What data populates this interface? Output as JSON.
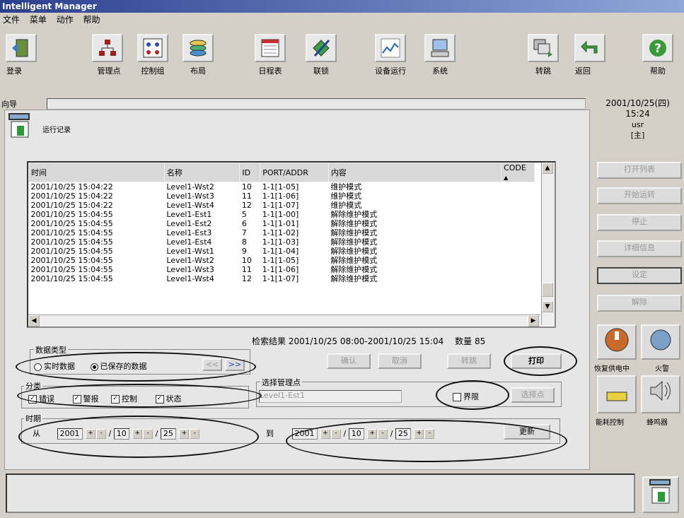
{
  "window": {
    "title": "Intelligent Manager"
  },
  "menu": {
    "file": "文件",
    "menu": "菜单",
    "action": "动作",
    "help": "帮助"
  },
  "toolbar": {
    "login": "登录",
    "mgmt_point": "管理点",
    "control_group": "控制组",
    "layout": "布局",
    "schedule": "日程表",
    "interlock": "联锁",
    "device_run": "设备运行",
    "system": "系统",
    "switch": "转跳",
    "back": "返回",
    "help": "帮助"
  },
  "nav": {
    "label": "向导"
  },
  "page": {
    "title": "运行记录"
  },
  "clock": {
    "date": "2001/10/25(四)",
    "time": "15:24",
    "user": "usr",
    "role": "[主]"
  },
  "side_buttons": {
    "open_list": "打开列表",
    "start_run": "开始运转",
    "stop": "停止",
    "detail": "详细信息",
    "settings": "设定",
    "dismiss": "解除"
  },
  "side_icons": {
    "restore_power": "恢复供电中",
    "fire_alarm": "火警",
    "energy_control": "能耗控制",
    "buzzer": "蜂鸣器"
  },
  "table": {
    "columns": [
      "时间",
      "名称",
      "ID",
      "PORT/ADDR",
      "内容",
      "CODE"
    ],
    "rows": [
      [
        "2001/10/25  15:04:22",
        "Level1-Wst2",
        "10",
        "1-1[1-05]",
        "维护模式",
        ""
      ],
      [
        "2001/10/25  15:04:22",
        "Level1-Wst3",
        "11",
        "1-1[1-06]",
        "维护模式",
        ""
      ],
      [
        "2001/10/25  15:04:22",
        "Level1-Wst4",
        "12",
        "1-1[1-07]",
        "维护模式",
        ""
      ],
      [
        "2001/10/25  15:04:55",
        "Level1-Est1",
        "5",
        "1-1[1-00]",
        "解除维护模式",
        ""
      ],
      [
        "2001/10/25  15:04:55",
        "Level1-Est2",
        "6",
        "1-1[1-01]",
        "解除维护模式",
        ""
      ],
      [
        "2001/10/25  15:04:55",
        "Level1-Est3",
        "7",
        "1-1[1-02]",
        "解除维护模式",
        ""
      ],
      [
        "2001/10/25  15:04:55",
        "Level1-Est4",
        "8",
        "1-1[1-03]",
        "解除维护模式",
        ""
      ],
      [
        "2001/10/25  15:04:55",
        "Level1-Wst1",
        "9",
        "1-1[1-04]",
        "解除维护模式",
        ""
      ],
      [
        "2001/10/25  15:04:55",
        "Level1-Wst2",
        "10",
        "1-1[1-05]",
        "解除维护模式",
        ""
      ],
      [
        "2001/10/25  15:04:55",
        "Level1-Wst3",
        "11",
        "1-1[1-06]",
        "解除维护模式",
        ""
      ],
      [
        "2001/10/25  15:04:55",
        "Level1-Wst4",
        "12",
        "1-1[1-07]",
        "解除维护模式",
        ""
      ]
    ]
  },
  "search": {
    "label": "检索结果",
    "range": "2001/10/25 08:00-2001/10/25 15:04",
    "count_label": "数量",
    "count": "85"
  },
  "data_type": {
    "title": "数据类型",
    "realtime": "实时数据",
    "saved": "已保存的数据",
    "prev": "<<",
    "next": ">>"
  },
  "buttons": {
    "confirm": "确认",
    "cancel": "取消",
    "jump": "转跳",
    "print": "打印",
    "refresh": "更新",
    "select": "选择点"
  },
  "mgmt_select": {
    "title": "选择管理点",
    "value": "Level1-Est1",
    "limit": "界限"
  },
  "category": {
    "title": "分类",
    "error": "错误",
    "alarm": "警报",
    "control": "控制",
    "status": "状态"
  },
  "period": {
    "title": "时期",
    "from": "从",
    "to": "到",
    "from_year": "2001",
    "from_month": "10",
    "from_day": "25",
    "to_year": "2001",
    "to_month": "10",
    "to_day": "25"
  },
  "colors": {
    "title_bar": "#2b3f8f",
    "panel": "#e6e6e6",
    "window": "#d4d0c8"
  }
}
